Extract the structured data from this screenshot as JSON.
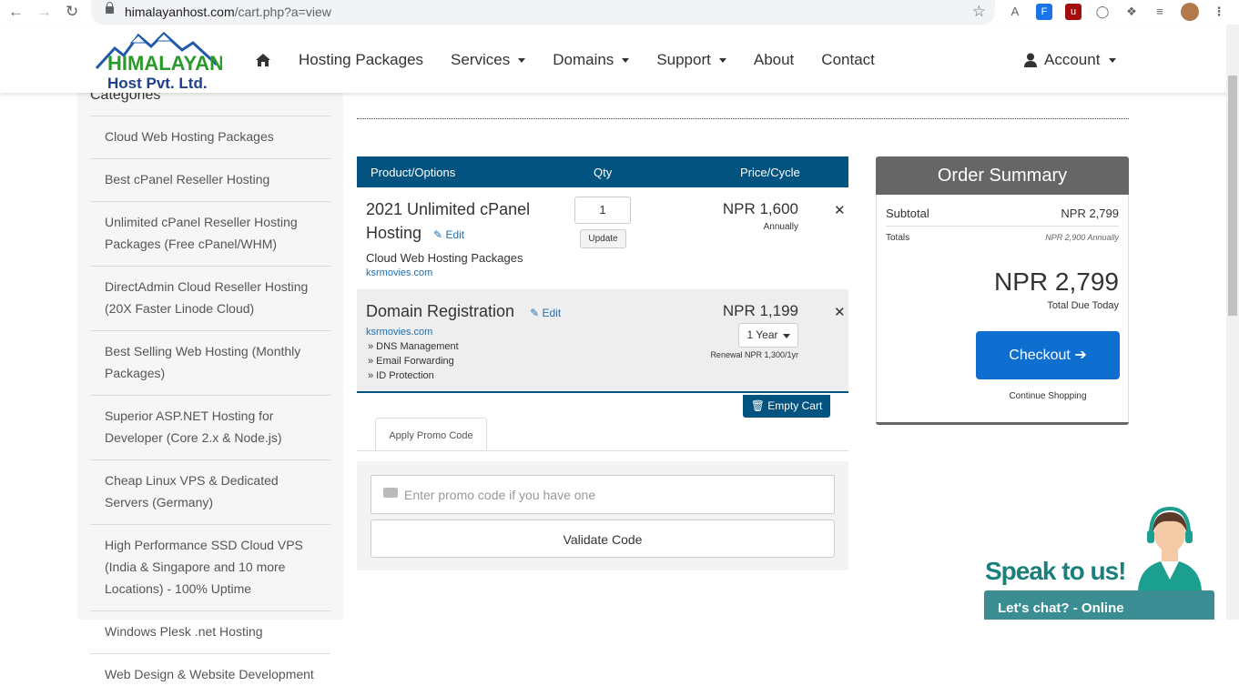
{
  "browser": {
    "url_host": "himalayanhost.com",
    "url_path": "/cart.php?a=view"
  },
  "brand": {
    "logo_line1": "HIMALAYAN",
    "logo_line2": "Host Pvt. Ltd."
  },
  "nav": {
    "items": [
      "Hosting Packages",
      "Services",
      "Domains",
      "Support",
      "About",
      "Contact"
    ],
    "account": "Account"
  },
  "sidebar": {
    "title": "Categories",
    "items": [
      "Cloud Web Hosting Packages",
      "Best cPanel Reseller Hosting",
      "Unlimited cPanel Reseller Hosting Packages (Free cPanel/WHM)",
      "DirectAdmin Cloud Reseller Hosting (20X Faster Linode Cloud)",
      "Best Selling Web Hosting (Monthly Packages)",
      "Superior ASP.NET Hosting for Developer (Core 2.x & Node.js)",
      "Cheap Linux VPS & Dedicated Servers (Germany)",
      "High Performance SSD Cloud VPS (India & Singapore and 10 more Locations) - 100% Uptime",
      "Windows Plesk .net Hosting",
      "Web Design & Website Development"
    ]
  },
  "cart": {
    "headers": {
      "product": "Product/Options",
      "qty": "Qty",
      "price": "Price/Cycle"
    },
    "items": [
      {
        "name_line1": "2021 Unlimited cPanel",
        "name_line2": "Hosting",
        "edit": "Edit",
        "group": "Cloud Web Hosting Packages",
        "domain": "ksrmovies.com",
        "qty": "1",
        "update": "Update",
        "price": "NPR 1,600",
        "cycle": "Annually"
      },
      {
        "name": "Domain Registration",
        "edit": "Edit",
        "domain": "ksrmovies.com",
        "addons": [
          "» DNS Management",
          "» Email Forwarding",
          "» ID Protection"
        ],
        "price": "NPR 1,199",
        "period": "1 Year",
        "renewal": "Renewal NPR 1,300/1yr"
      }
    ],
    "empty_cart": "Empty Cart",
    "promo_tab": "Apply Promo Code",
    "promo_placeholder": "Enter promo code if you have one",
    "validate": "Validate Code"
  },
  "summary": {
    "title": "Order Summary",
    "subtotal_label": "Subtotal",
    "subtotal": "NPR 2,799",
    "totals_label": "Totals",
    "totals": "NPR 2,900 Annually",
    "total_due": "NPR 2,799",
    "total_due_label": "Total Due Today",
    "checkout": "Checkout",
    "continue": "Continue Shopping"
  },
  "chat": {
    "headline": "Speak to us!",
    "status": "Let's chat? - Online"
  },
  "colors": {
    "primary": "#035380",
    "checkout": "#0e6fd0",
    "chat": "#3a8e93"
  }
}
